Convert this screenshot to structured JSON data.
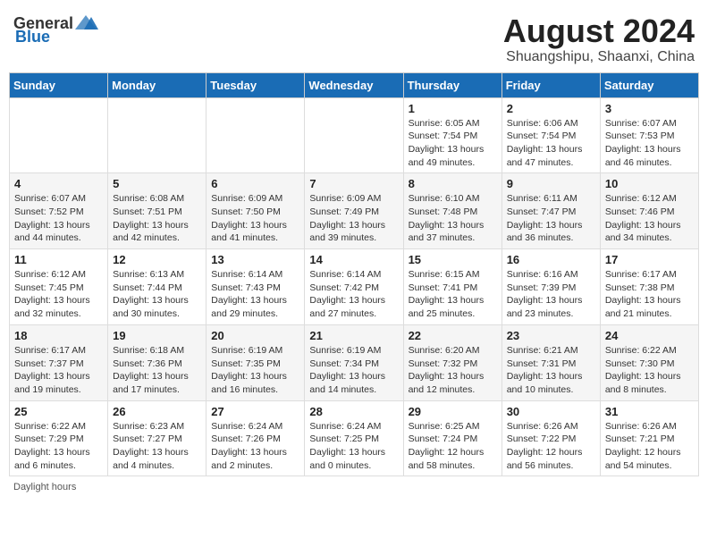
{
  "header": {
    "logo_general": "General",
    "logo_blue": "Blue",
    "month": "August 2024",
    "location": "Shuangshipu, Shaanxi, China"
  },
  "days_of_week": [
    "Sunday",
    "Monday",
    "Tuesday",
    "Wednesday",
    "Thursday",
    "Friday",
    "Saturday"
  ],
  "weeks": [
    [
      {
        "day": "",
        "info": ""
      },
      {
        "day": "",
        "info": ""
      },
      {
        "day": "",
        "info": ""
      },
      {
        "day": "",
        "info": ""
      },
      {
        "day": "1",
        "info": "Sunrise: 6:05 AM\nSunset: 7:54 PM\nDaylight: 13 hours and 49 minutes."
      },
      {
        "day": "2",
        "info": "Sunrise: 6:06 AM\nSunset: 7:54 PM\nDaylight: 13 hours and 47 minutes."
      },
      {
        "day": "3",
        "info": "Sunrise: 6:07 AM\nSunset: 7:53 PM\nDaylight: 13 hours and 46 minutes."
      }
    ],
    [
      {
        "day": "4",
        "info": "Sunrise: 6:07 AM\nSunset: 7:52 PM\nDaylight: 13 hours and 44 minutes."
      },
      {
        "day": "5",
        "info": "Sunrise: 6:08 AM\nSunset: 7:51 PM\nDaylight: 13 hours and 42 minutes."
      },
      {
        "day": "6",
        "info": "Sunrise: 6:09 AM\nSunset: 7:50 PM\nDaylight: 13 hours and 41 minutes."
      },
      {
        "day": "7",
        "info": "Sunrise: 6:09 AM\nSunset: 7:49 PM\nDaylight: 13 hours and 39 minutes."
      },
      {
        "day": "8",
        "info": "Sunrise: 6:10 AM\nSunset: 7:48 PM\nDaylight: 13 hours and 37 minutes."
      },
      {
        "day": "9",
        "info": "Sunrise: 6:11 AM\nSunset: 7:47 PM\nDaylight: 13 hours and 36 minutes."
      },
      {
        "day": "10",
        "info": "Sunrise: 6:12 AM\nSunset: 7:46 PM\nDaylight: 13 hours and 34 minutes."
      }
    ],
    [
      {
        "day": "11",
        "info": "Sunrise: 6:12 AM\nSunset: 7:45 PM\nDaylight: 13 hours and 32 minutes."
      },
      {
        "day": "12",
        "info": "Sunrise: 6:13 AM\nSunset: 7:44 PM\nDaylight: 13 hours and 30 minutes."
      },
      {
        "day": "13",
        "info": "Sunrise: 6:14 AM\nSunset: 7:43 PM\nDaylight: 13 hours and 29 minutes."
      },
      {
        "day": "14",
        "info": "Sunrise: 6:14 AM\nSunset: 7:42 PM\nDaylight: 13 hours and 27 minutes."
      },
      {
        "day": "15",
        "info": "Sunrise: 6:15 AM\nSunset: 7:41 PM\nDaylight: 13 hours and 25 minutes."
      },
      {
        "day": "16",
        "info": "Sunrise: 6:16 AM\nSunset: 7:39 PM\nDaylight: 13 hours and 23 minutes."
      },
      {
        "day": "17",
        "info": "Sunrise: 6:17 AM\nSunset: 7:38 PM\nDaylight: 13 hours and 21 minutes."
      }
    ],
    [
      {
        "day": "18",
        "info": "Sunrise: 6:17 AM\nSunset: 7:37 PM\nDaylight: 13 hours and 19 minutes."
      },
      {
        "day": "19",
        "info": "Sunrise: 6:18 AM\nSunset: 7:36 PM\nDaylight: 13 hours and 17 minutes."
      },
      {
        "day": "20",
        "info": "Sunrise: 6:19 AM\nSunset: 7:35 PM\nDaylight: 13 hours and 16 minutes."
      },
      {
        "day": "21",
        "info": "Sunrise: 6:19 AM\nSunset: 7:34 PM\nDaylight: 13 hours and 14 minutes."
      },
      {
        "day": "22",
        "info": "Sunrise: 6:20 AM\nSunset: 7:32 PM\nDaylight: 13 hours and 12 minutes."
      },
      {
        "day": "23",
        "info": "Sunrise: 6:21 AM\nSunset: 7:31 PM\nDaylight: 13 hours and 10 minutes."
      },
      {
        "day": "24",
        "info": "Sunrise: 6:22 AM\nSunset: 7:30 PM\nDaylight: 13 hours and 8 minutes."
      }
    ],
    [
      {
        "day": "25",
        "info": "Sunrise: 6:22 AM\nSunset: 7:29 PM\nDaylight: 13 hours and 6 minutes."
      },
      {
        "day": "26",
        "info": "Sunrise: 6:23 AM\nSunset: 7:27 PM\nDaylight: 13 hours and 4 minutes."
      },
      {
        "day": "27",
        "info": "Sunrise: 6:24 AM\nSunset: 7:26 PM\nDaylight: 13 hours and 2 minutes."
      },
      {
        "day": "28",
        "info": "Sunrise: 6:24 AM\nSunset: 7:25 PM\nDaylight: 13 hours and 0 minutes."
      },
      {
        "day": "29",
        "info": "Sunrise: 6:25 AM\nSunset: 7:24 PM\nDaylight: 12 hours and 58 minutes."
      },
      {
        "day": "30",
        "info": "Sunrise: 6:26 AM\nSunset: 7:22 PM\nDaylight: 12 hours and 56 minutes."
      },
      {
        "day": "31",
        "info": "Sunrise: 6:26 AM\nSunset: 7:21 PM\nDaylight: 12 hours and 54 minutes."
      }
    ]
  ],
  "footer": {
    "note": "Daylight hours"
  }
}
